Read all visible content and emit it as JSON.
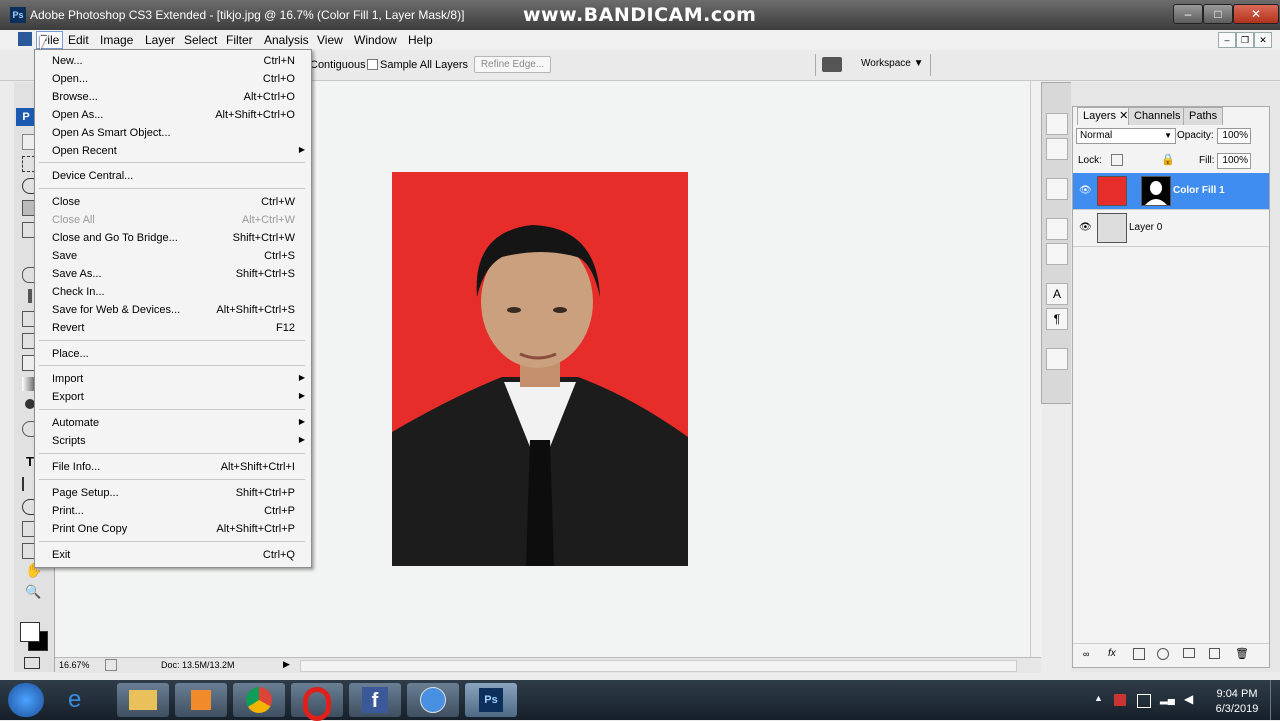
{
  "window": {
    "title": "Adobe Photoshop CS3 Extended - [tikjo.jpg @ 16.7% (Color Fill 1, Layer Mask/8)]",
    "watermark": "www.BANDICAM.com",
    "app_icon": "Ps"
  },
  "menubar": {
    "items": [
      "File",
      "Edit",
      "Image",
      "Layer",
      "Select",
      "Filter",
      "Analysis",
      "View",
      "Window",
      "Help"
    ],
    "active": "File"
  },
  "options": {
    "contiguous_label": "Contiguous",
    "sample_all_layers_label": "Sample All Layers",
    "refine_edge_label": "Refine Edge...",
    "workspace_label": "Workspace"
  },
  "file_menu": {
    "items": [
      {
        "label": "New...",
        "shortcut": "Ctrl+N"
      },
      {
        "label": "Open...",
        "shortcut": "Ctrl+O"
      },
      {
        "label": "Browse...",
        "shortcut": "Alt+Ctrl+O"
      },
      {
        "label": "Open As...",
        "shortcut": "Alt+Shift+Ctrl+O"
      },
      {
        "label": "Open As Smart Object...",
        "shortcut": ""
      },
      {
        "label": "Open Recent",
        "shortcut": "",
        "submenu": true
      },
      {
        "label": "Device Central...",
        "shortcut": ""
      },
      {
        "label": "Close",
        "shortcut": "Ctrl+W"
      },
      {
        "label": "Close All",
        "shortcut": "Alt+Ctrl+W",
        "disabled": true
      },
      {
        "label": "Close and Go To Bridge...",
        "shortcut": "Shift+Ctrl+W"
      },
      {
        "label": "Save",
        "shortcut": "Ctrl+S"
      },
      {
        "label": "Save As...",
        "shortcut": "Shift+Ctrl+S"
      },
      {
        "label": "Check In...",
        "shortcut": ""
      },
      {
        "label": "Save for Web & Devices...",
        "shortcut": "Alt+Shift+Ctrl+S"
      },
      {
        "label": "Revert",
        "shortcut": "F12"
      },
      {
        "label": "Place...",
        "shortcut": ""
      },
      {
        "label": "Import",
        "shortcut": "",
        "submenu": true
      },
      {
        "label": "Export",
        "shortcut": "",
        "submenu": true
      },
      {
        "label": "Automate",
        "shortcut": "",
        "submenu": true
      },
      {
        "label": "Scripts",
        "shortcut": "",
        "submenu": true
      },
      {
        "label": "File Info...",
        "shortcut": "Alt+Shift+Ctrl+I"
      },
      {
        "label": "Page Setup...",
        "shortcut": "Shift+Ctrl+P"
      },
      {
        "label": "Print...",
        "shortcut": "Ctrl+P"
      },
      {
        "label": "Print One Copy",
        "shortcut": "Alt+Shift+Ctrl+P"
      },
      {
        "label": "Exit",
        "shortcut": "Ctrl+Q"
      }
    ]
  },
  "status": {
    "zoom": "16.67%",
    "doc": "Doc: 13.5M/13.2M"
  },
  "layers_panel": {
    "tabs": [
      "Layers",
      "Channels",
      "Paths"
    ],
    "blend_mode": "Normal",
    "opacity_label": "Opacity:",
    "opacity": "100%",
    "lock_label": "Lock:",
    "fill_label": "Fill:",
    "fill": "100%",
    "layers": [
      {
        "name": "Color Fill 1",
        "selected": true
      },
      {
        "name": "Layer 0",
        "selected": false
      }
    ]
  },
  "taskbar": {
    "time": "9:04 PM",
    "date": "6/3/2019",
    "apps": [
      "file-explorer",
      "media-player",
      "chrome",
      "opera",
      "facebook",
      "chrome-alt",
      "photoshop"
    ]
  },
  "colors": {
    "fill_red": "#e62d2a",
    "selection_blue": "#3f8df0"
  }
}
